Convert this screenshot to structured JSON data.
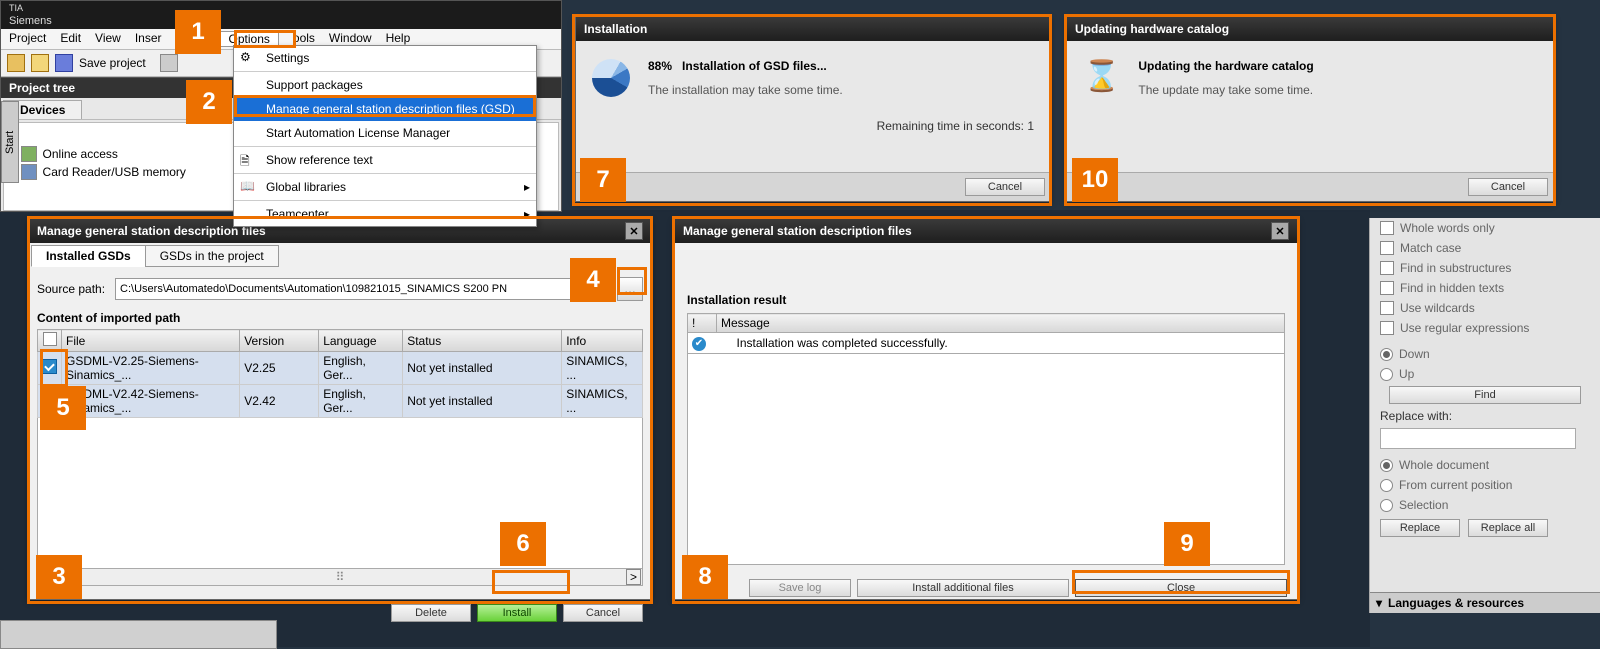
{
  "app": {
    "title": "Siemens"
  },
  "menubar": [
    "Project",
    "Edit",
    "View",
    "Inser",
    "",
    "",
    "Options",
    "ools",
    "Window",
    "Help"
  ],
  "toolbar": {
    "save_label": "Save project"
  },
  "project_tree": {
    "title": "Project tree",
    "tab": "Devices",
    "items": [
      "Online access",
      "Card Reader/USB memory"
    ]
  },
  "start_tab": "Start",
  "options_menu": {
    "items": [
      {
        "label": "Settings",
        "icon": "gear"
      },
      {
        "label": "Support packages",
        "icon": ""
      },
      {
        "label": "Manage general station description files (GSD)",
        "icon": "",
        "selected": true
      },
      {
        "label": "Start Automation License Manager",
        "icon": ""
      },
      {
        "label": "Show reference text",
        "icon": "doc"
      },
      {
        "label": "Global libraries",
        "icon": "book",
        "submenu": true
      },
      {
        "label": "Teamcenter",
        "icon": "",
        "submenu": true
      }
    ]
  },
  "install_progress": {
    "title": "Installation",
    "percent": "88%",
    "headline": "Installation of GSD files...",
    "note": "The installation may take some time.",
    "remaining": "Remaining time in seconds: 1",
    "cancel": "Cancel"
  },
  "update_catalog": {
    "title": "Updating hardware catalog",
    "headline": "Updating the hardware catalog",
    "note": "The update may take some time.",
    "cancel": "Cancel"
  },
  "gsd1": {
    "title": "Manage general station description files",
    "tabs": [
      "Installed GSDs",
      "GSDs in the project"
    ],
    "source_label": "Source path:",
    "source_value": "C:\\Users\\Automatedo\\Documents\\Automation\\109821015_SINAMICS S200 PN",
    "content_label": "Content of imported path",
    "cols": [
      "",
      "File",
      "Version",
      "Language",
      "Status",
      "Info"
    ],
    "rows": [
      {
        "file": "GSDML-V2.25-Siemens-Sinamics_...",
        "version": "V2.25",
        "language": "English, Ger...",
        "status": "Not yet installed",
        "info": "SINAMICS, ..."
      },
      {
        "file": "GSDML-V2.42-Siemens-Sinamics_...",
        "version": "V2.42",
        "language": "English, Ger...",
        "status": "Not yet installed",
        "info": "SINAMICS, ..."
      }
    ],
    "btn_delete": "Delete",
    "btn_install": "Install",
    "btn_cancel": "Cancel"
  },
  "gsd2": {
    "title": "Manage general station description files",
    "result_title": "Installation result",
    "col_excl": "!",
    "col_msg": "Message",
    "msg": "Installation was completed successfully.",
    "btn_savelog": "Save log",
    "btn_addl": "Install additional files",
    "btn_close": "Close"
  },
  "find_panel": {
    "opts": [
      "Whole words only",
      "Match case",
      "Find in substructures",
      "Find in hidden texts",
      "Use wildcards",
      "Use regular expressions"
    ],
    "dir_down": "Down",
    "dir_up": "Up",
    "btn_find": "Find",
    "replace_label": "Replace with:",
    "scope": [
      "Whole document",
      "From current position",
      "Selection"
    ],
    "btn_replace": "Replace",
    "btn_replace_all": "Replace all",
    "footer": "Languages & resources"
  },
  "annots": [
    "1",
    "2",
    "3",
    "4",
    "5",
    "6",
    "7",
    "8",
    "9",
    "10"
  ]
}
